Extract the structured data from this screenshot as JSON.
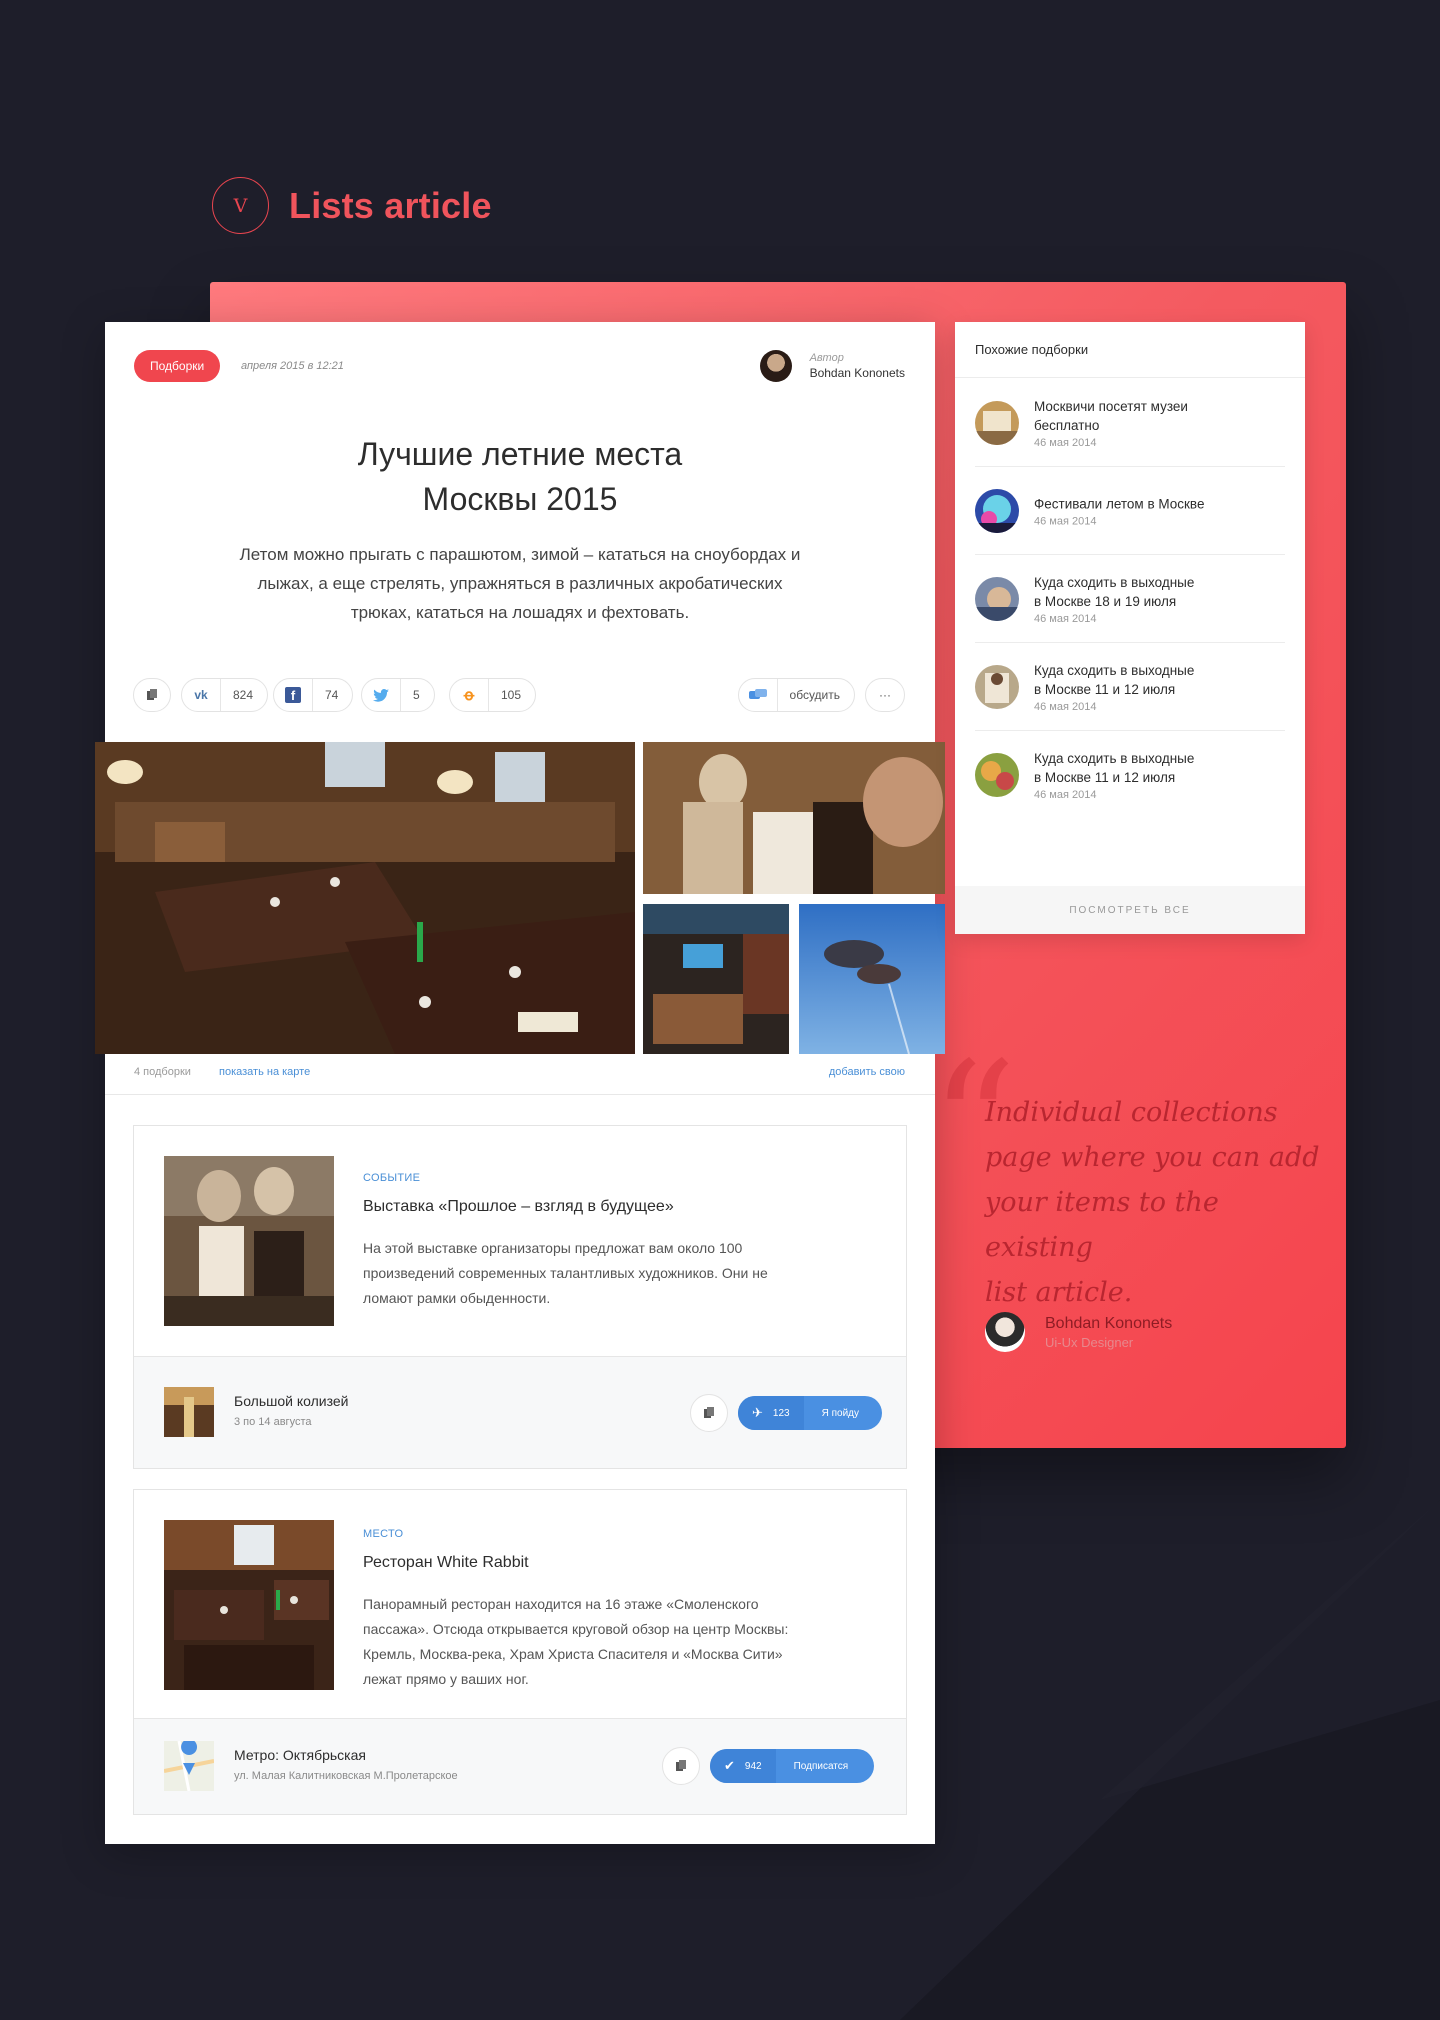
{
  "section": {
    "numeral": "V",
    "title": "Lists article"
  },
  "article": {
    "tag": "Подборки",
    "date": "апреля 2015 в 12:21",
    "author_label": "Автор",
    "author_name": "Bohdan Kononets",
    "title_line1": "Лучшие летние места",
    "title_line2": "Москвы 2015",
    "lead_line1": "Летом можно прыгать с парашютом, зимой – кататься на сноубордах и",
    "lead_line2": "лыжах, а еще стрелять, упражняться в различных акробатических",
    "lead_line3": "трюках, кататься на лошадях и фехтовать."
  },
  "share": {
    "vk_count": "824",
    "fb_count": "74",
    "tw_count": "5",
    "ok_count": "105",
    "discuss_label": "обсудить",
    "more_label": "···"
  },
  "collage_footer": {
    "count": "4 подборки",
    "map_link": "показать на карте",
    "add_link": "добавить свою"
  },
  "items": [
    {
      "kind": "Событие",
      "title": "Выставка «Прошлое – взгляд в будущее»",
      "desc_line1": "На этой выставке организаторы предложат вам около 100",
      "desc_line2": "произведений современных талантливых художников. Они не",
      "desc_line3": "ломают рамки обыденности.",
      "sub_title": "Большой колизей",
      "sub_meta": "3 по 14 августа",
      "action_count": "123",
      "action_label": "Я пойду"
    },
    {
      "kind": "Место",
      "title": "Ресторан White Rabbit",
      "desc_line1": "Панорамный ресторан находится на 16 этаже «Смоленского",
      "desc_line2": "пассажа». Отсюда открывается круговой обзор на центр Москвы:",
      "desc_line3": "Кремль, Москва-река, Храм Христа Спасителя и «Москва Сити»",
      "desc_line4": "лежат прямо у ваших ног.",
      "sub_title": "Метро: Октябрьская",
      "sub_meta": "ул. Малая Калитниковская М.Пролетарское",
      "action_count": "942",
      "action_label": "Подписатся"
    }
  ],
  "sidebar": {
    "heading": "Похожие подборки",
    "items": [
      {
        "title_line1": "Москвичи посетят музеи",
        "title_line2": "бесплатно",
        "date": "46 мая 2014"
      },
      {
        "title_line1": "Фестивали летом в Москве",
        "title_line2": "",
        "date": "46 мая 2014"
      },
      {
        "title_line1": "Куда сходить в выходные",
        "title_line2": "в Москве 18 и 19 июля",
        "date": "46 мая 2014"
      },
      {
        "title_line1": "Куда сходить в выходные",
        "title_line2": "в Москве 11 и 12 июля",
        "date": "46 мая 2014"
      },
      {
        "title_line1": "Куда сходить в выходные",
        "title_line2": "в Москве 11 и 12 июля",
        "date": "46 мая 2014"
      }
    ],
    "view_all": "ПОСМОТРЕТЬ ВСЕ"
  },
  "quote": {
    "line1": "Individual collections",
    "line2": "page where you can add",
    "line3": "your items to the existing",
    "line4": "list article.",
    "author_name": "Bohdan Kononets",
    "author_role": "Ui-Ux Designer"
  },
  "colors": {
    "accent_red": "#f0464e",
    "link_blue": "#4a8fd6",
    "background": "#1e1e2a"
  }
}
